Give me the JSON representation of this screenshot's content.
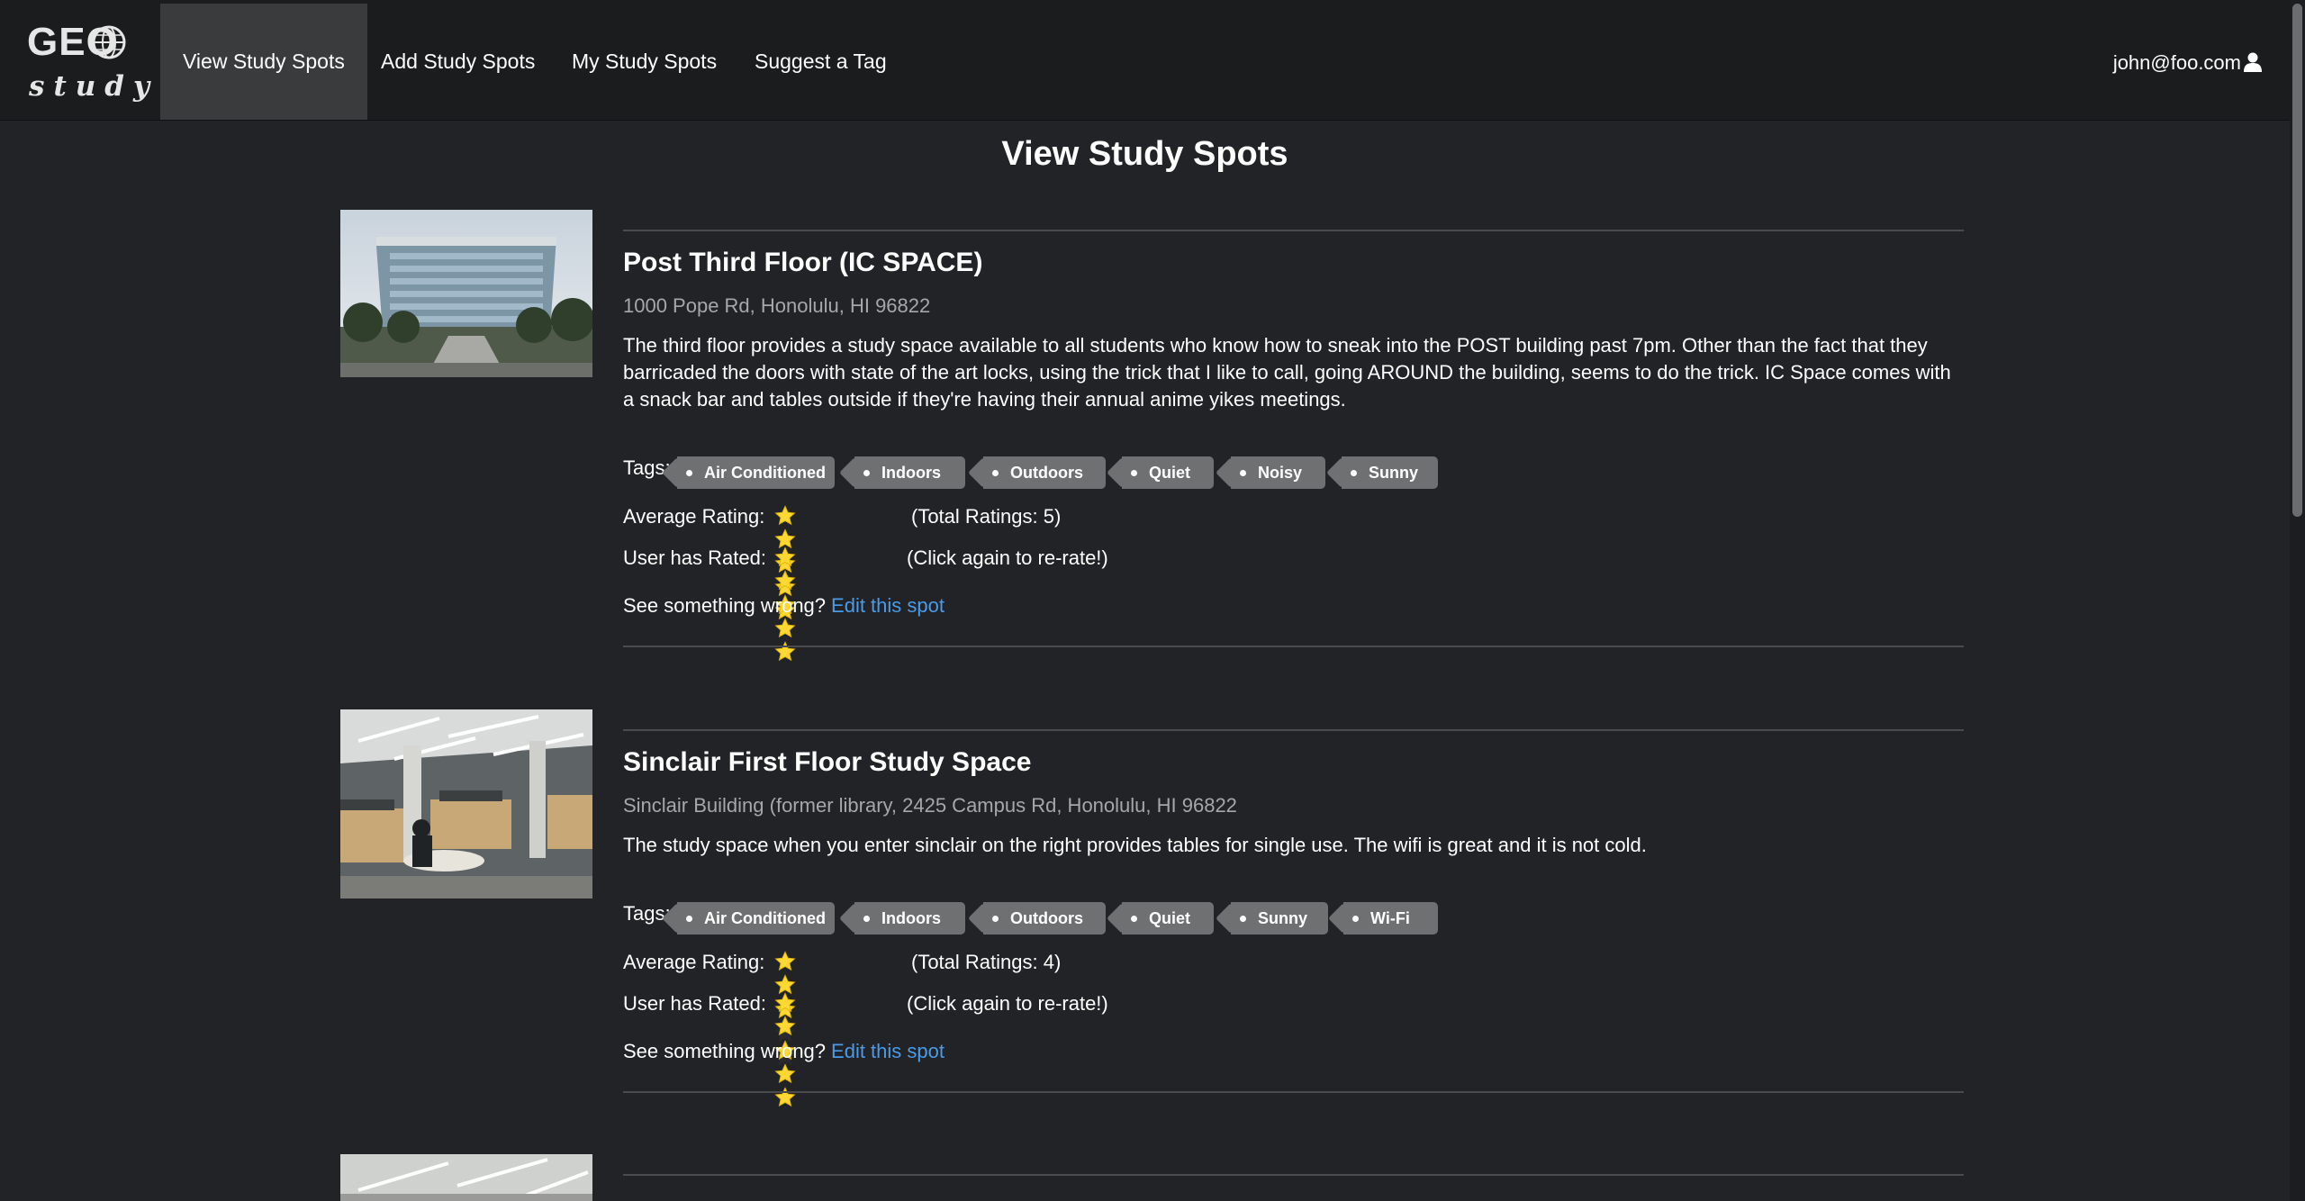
{
  "logo": {
    "top": "GEO",
    "bottom": "study"
  },
  "nav": {
    "items": [
      {
        "label": "View Study Spots",
        "active": true
      },
      {
        "label": "Add Study Spots",
        "active": false
      },
      {
        "label": "My Study Spots",
        "active": false
      },
      {
        "label": "Suggest a Tag",
        "active": false
      }
    ],
    "user": "john@foo.com",
    "user_icon": "user-icon"
  },
  "page": {
    "title": "View Study Spots"
  },
  "labels": {
    "tags": "Tags:",
    "average_rating": "Average Rating:",
    "user_rated": "User has Rated:",
    "see_wrong": "See something wrong?",
    "edit_link": "Edit this spot"
  },
  "spots": [
    {
      "name": "Post Third Floor (IC SPACE)",
      "address": "1000 Pope Rd, Honolulu, HI 96822",
      "description": "The third floor provides a study space available to all students who know how to sneak into the POST building past 7pm. Other than the fact that they barricaded the doors with state of the art locks, using the trick that I like to call, going AROUND the building, seems to do the trick. IC Space comes with a snack bar and tables outside if they're having their annual anime yikes meetings.",
      "tags": [
        "Air Conditioned",
        "Indoors",
        "Outdoors",
        "Quiet",
        "Noisy",
        "Sunny"
      ],
      "average_rating": 5,
      "total_ratings": "(Total Ratings: 5)",
      "user_rating": 5,
      "rerate": "(Click again to re-rate!)"
    },
    {
      "name": "Sinclair First Floor Study Space",
      "address": "Sinclair Building (former library, 2425 Campus Rd, Honolulu, HI 96822",
      "description": "The study space when you enter sinclair on the right provides tables for single use. The wifi is great and it is not cold.",
      "tags": [
        "Air Conditioned",
        "Indoors",
        "Outdoors",
        "Quiet",
        "Sunny",
        "Wi-Fi"
      ],
      "average_rating": 3,
      "total_ratings": "(Total Ratings: 4)",
      "user_rating": 5,
      "rerate": "(Click again to re-rate!)"
    }
  ],
  "colors": {
    "background": "#222326",
    "navbar": "#1b1c1d",
    "tag": "#6f7072",
    "star": "#fdd835",
    "link": "#4a9be8"
  }
}
